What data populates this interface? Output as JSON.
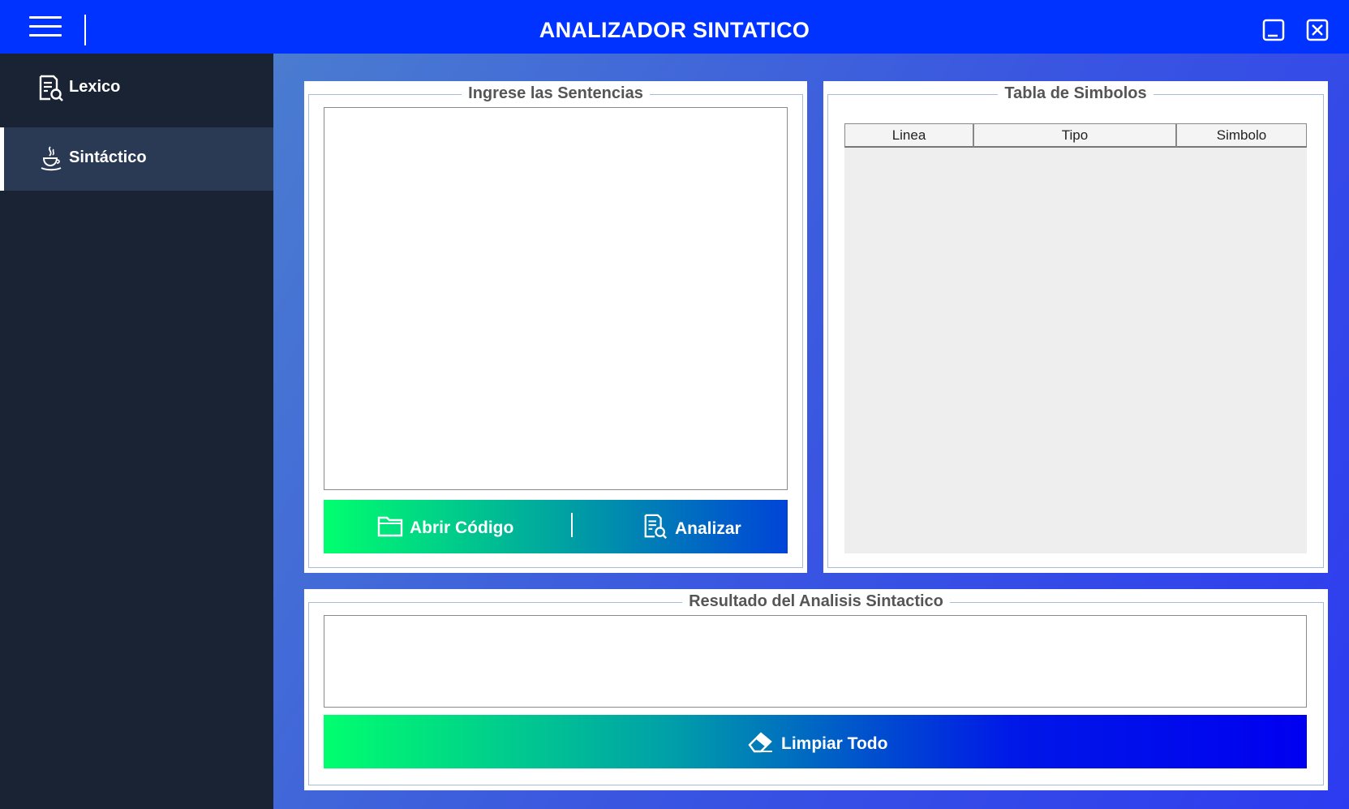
{
  "window": {
    "title": "ANALIZADOR SINTATICO",
    "menu_icon": "hamburger-menu-icon",
    "minimize_icon": "minimize-icon",
    "close_icon": "close-icon"
  },
  "sidebar": {
    "items": [
      {
        "label": "Lexico",
        "icon": "document-search-icon",
        "active": false
      },
      {
        "label": "Sintáctico",
        "icon": "java-cup-icon",
        "active": true
      }
    ]
  },
  "input_panel": {
    "legend": "Ingrese las Sentencias",
    "code_value": "",
    "open_button": {
      "label": "Abrir Código",
      "icon": "folder-icon"
    },
    "analyze_button": {
      "label": "Analizar",
      "icon": "document-search-icon"
    }
  },
  "symbols_panel": {
    "legend": "Tabla de Simbolos",
    "columns": [
      "Linea",
      "Tipo",
      "Simbolo"
    ],
    "rows": []
  },
  "result_panel": {
    "legend": "Resultado del Analisis Sintactico",
    "result_value": "",
    "clear_button": {
      "label": "Limpiar Todo",
      "icon": "eraser-icon"
    }
  },
  "colors": {
    "titlebar": "#0033ff",
    "sidebar": "#192333",
    "sidebar_active": "#2a3a55",
    "gradient_start": "#00ff6e",
    "gradient_end": "#0000f0"
  }
}
